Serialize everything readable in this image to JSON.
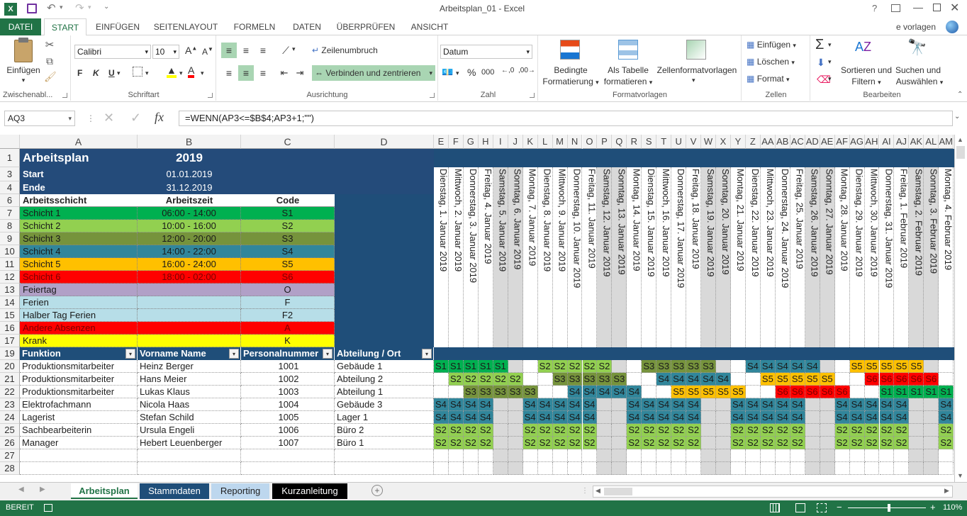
{
  "window": {
    "title": "Arbeitsplan_01 - Excel",
    "help": "?"
  },
  "tabs": {
    "file": "DATEI",
    "items": [
      "START",
      "EINFÜGEN",
      "SEITENLAYOUT",
      "FORMELN",
      "DATEN",
      "ÜBERPRÜFEN",
      "ANSICHT"
    ],
    "active": "START",
    "user": "e vorlagen"
  },
  "ribbon": {
    "clipboard": {
      "label": "Zwischenabl...",
      "paste": "Einfügen"
    },
    "font": {
      "label": "Schriftart",
      "name": "Calibri",
      "size": "10",
      "bold": "F",
      "italic": "K",
      "underline": "U"
    },
    "align": {
      "label": "Ausrichtung",
      "wrap": "Zeilenumbruch",
      "merge": "Verbinden und zentrieren"
    },
    "number": {
      "label": "Zahl",
      "format": "Datum",
      "percent": "%",
      "thousands": "000"
    },
    "styles": {
      "label": "Formatvorlagen",
      "cond1": "Bedingte",
      "cond2": "Formatierung",
      "table1": "Als Tabelle",
      "table2": "formatieren",
      "cell": "Zellenformatvorlagen"
    },
    "cells": {
      "label": "Zellen",
      "insert": "Einfügen",
      "delete": "Löschen",
      "format": "Format"
    },
    "edit": {
      "label": "Bearbeiten",
      "sort1": "Sortieren und",
      "sort2": "Filtern",
      "find1": "Suchen und",
      "find2": "Auswählen"
    }
  },
  "formula": {
    "namebox": "AQ3",
    "fx": "fx",
    "content": "=WENN(AP3<=$B$4;AP3+1;\"\")"
  },
  "columns": {
    "fixed": [
      "A",
      "B",
      "C",
      "D"
    ],
    "dates": [
      "E",
      "F",
      "G",
      "H",
      "I",
      "J",
      "K",
      "L",
      "M",
      "N",
      "O",
      "P",
      "Q",
      "R",
      "S",
      "T",
      "U",
      "V",
      "W",
      "X",
      "Y",
      "Z",
      "AA",
      "AB",
      "AC",
      "AD",
      "AE",
      "AF",
      "AG",
      "AH",
      "AI",
      "AJ",
      "AK",
      "AL",
      "AM"
    ]
  },
  "rows": [
    "1",
    "3",
    "4",
    "6",
    "7",
    "8",
    "9",
    "10",
    "11",
    "12",
    "13",
    "14",
    "15",
    "16",
    "17",
    "19",
    "20",
    "21",
    "22",
    "23",
    "24",
    "25",
    "26",
    "27",
    "28"
  ],
  "plan": {
    "title": "Arbeitsplan",
    "year": "2019",
    "start_label": "Start",
    "start": "01.01.2019",
    "end_label": "Ende",
    "end": "31.12.2019",
    "legend_headers": [
      "Arbeitsschicht",
      "Arbeitszeit",
      "Code"
    ],
    "legend": [
      {
        "name": "Schicht 1",
        "time": "06:00 - 14:00",
        "code": "S1",
        "bg": "#00b050",
        "fg": "#1a1a1a"
      },
      {
        "name": "Schicht 2",
        "time": "10:00 - 16:00",
        "code": "S2",
        "bg": "#92d050",
        "fg": "#1a1a1a"
      },
      {
        "name": "Schicht 3",
        "time": "12:00 - 20:00",
        "code": "S3",
        "bg": "#76933c",
        "fg": "#1a1a1a"
      },
      {
        "name": "Schicht 4",
        "time": "14:00 - 22:00",
        "code": "S4",
        "bg": "#31869b",
        "fg": "#1a1a1a"
      },
      {
        "name": "Schicht 5",
        "time": "16:00 - 24:00",
        "code": "S5",
        "bg": "#ffc000",
        "fg": "#1a1a1a"
      },
      {
        "name": "Schicht 6",
        "time": "18:00 - 02:00",
        "code": "S6",
        "bg": "#ff0000",
        "fg": "#7a0000"
      },
      {
        "name": "Feiertag",
        "time": "",
        "code": "O",
        "bg": "#b1a0c7",
        "fg": "#1a1a1a"
      },
      {
        "name": "Ferien",
        "time": "",
        "code": "F",
        "bg": "#b7dee8",
        "fg": "#1a1a1a"
      },
      {
        "name": "Halber Tag Ferien",
        "time": "",
        "code": "F2",
        "bg": "#b7dee8",
        "fg": "#1a1a1a"
      },
      {
        "name": "Andere Absenzen",
        "time": "",
        "code": "A",
        "bg": "#ff0000",
        "fg": "#7a0000"
      },
      {
        "name": "Krank",
        "time": "",
        "code": "K",
        "bg": "#ffff00",
        "fg": "#1a1a1a"
      }
    ]
  },
  "dates": [
    "Dienstag, 1. Januar 2019",
    "Mittwoch, 2. Januar 2019",
    "Donnerstag, 3. Januar 2019",
    "Freitag, 4. Januar 2019",
    "Samstag, 5. Januar 2019",
    "Sonntag, 6. Januar 2019",
    "Montag, 7. Januar 2019",
    "Dienstag, 8. Januar 2019",
    "Mittwoch, 9. Januar 2019",
    "Donnerstag, 10. Januar 2019",
    "Freitag, 11. Januar 2019",
    "Samstag, 12. Januar 2019",
    "Sonntag, 13. Januar 2019",
    "Montag, 14. Januar 2019",
    "Dienstag, 15. Januar 2019",
    "Mittwoch, 16. Januar 2019",
    "Donnerstag, 17. Januar 2019",
    "Freitag, 18. Januar 2019",
    "Samstag, 19. Januar 2019",
    "Sonntag, 20. Januar 2019",
    "Montag, 21. Januar 2019",
    "Dienstag, 22. Januar 2019",
    "Mittwoch, 23. Januar 2019",
    "Donnerstag, 24. Januar 2019",
    "Freitag, 25. Januar 2019",
    "Samstag, 26. Januar 2019",
    "Sonntag, 27. Januar 2019",
    "Montag, 28. Januar 2019",
    "Dienstag, 29. Januar 2019",
    "Mittwoch, 30. Januar 2019",
    "Donnerstag, 31. Januar 2019",
    "Freitag, 1. Februar 2019",
    "Samstag, 2. Februar 2019",
    "Sonntag, 3. Februar 2019",
    "Montag, 4. Februar 2019"
  ],
  "table_headers": [
    "Funktion",
    "Vorname Name",
    "Personalnummer",
    "Abteilung / Ort"
  ],
  "employees": [
    {
      "funktion": "Produktionsmitarbeiter",
      "name": "Heinz Berger",
      "nr": "1001",
      "abt": "Gebäude 1",
      "shifts": [
        "S1",
        "S1",
        "S1",
        "S1",
        "S1",
        "",
        "",
        "S2",
        "S2",
        "S2",
        "S2",
        "S2",
        "",
        "",
        "S3",
        "S3",
        "S3",
        "S3",
        "S3",
        "",
        "",
        "S4",
        "S4",
        "S4",
        "S4",
        "S4",
        "",
        "",
        "S5",
        "S5",
        "S5",
        "S5",
        "S5",
        "",
        ""
      ]
    },
    {
      "funktion": "Produktionsmitarbeiter",
      "name": "Hans Meier",
      "nr": "1002",
      "abt": "Abteilung 2",
      "shifts": [
        "",
        "S2",
        "S2",
        "S2",
        "S2",
        "S2",
        "",
        "",
        "S3",
        "S3",
        "S3",
        "S3",
        "S3",
        "",
        "",
        "S4",
        "S4",
        "S4",
        "S4",
        "S4",
        "",
        "",
        "S5",
        "S5",
        "S5",
        "S5",
        "S5",
        "",
        "",
        "S6",
        "S6",
        "S6",
        "S6",
        "S6",
        ""
      ]
    },
    {
      "funktion": "Produktionsmitarbeiter",
      "name": "Lukas Klaus",
      "nr": "1003",
      "abt": "Abteilung 1",
      "shifts": [
        "",
        "",
        "S3",
        "S3",
        "S3",
        "S3",
        "S3",
        "",
        "",
        "S4",
        "S4",
        "S4",
        "S4",
        "S4",
        "",
        "",
        "S5",
        "S5",
        "S5",
        "S5",
        "S5",
        "",
        "",
        "S6",
        "S6",
        "S6",
        "S6",
        "S6",
        "",
        "",
        "S1",
        "S1",
        "S1",
        "S1",
        "S1"
      ]
    },
    {
      "funktion": "Elektrofachmann",
      "name": "Nicola Haas",
      "nr": "1004",
      "abt": "Gebäude 3",
      "shifts": [
        "S4",
        "S4",
        "S4",
        "S4",
        "",
        "",
        "S4",
        "S4",
        "S4",
        "S4",
        "S4",
        "",
        "",
        "S4",
        "S4",
        "S4",
        "S4",
        "S4",
        "",
        "",
        "S4",
        "S4",
        "S4",
        "S4",
        "S4",
        "",
        "",
        "S4",
        "S4",
        "S4",
        "S4",
        "S4",
        "",
        "",
        "S4"
      ]
    },
    {
      "funktion": "Lagerist",
      "name": "Stefan Schild",
      "nr": "1005",
      "abt": "Lager 1",
      "shifts": [
        "S4",
        "S4",
        "S4",
        "S4",
        "",
        "",
        "S4",
        "S4",
        "S4",
        "S4",
        "S4",
        "",
        "",
        "S4",
        "S4",
        "S4",
        "S4",
        "S4",
        "",
        "",
        "S4",
        "S4",
        "S4",
        "S4",
        "S4",
        "",
        "",
        "S4",
        "S4",
        "S4",
        "S4",
        "S4",
        "",
        "",
        "S4"
      ]
    },
    {
      "funktion": "Sachbearbeiterin",
      "name": "Ursula Engeli",
      "nr": "1006",
      "abt": "Büro 2",
      "shifts": [
        "S2",
        "S2",
        "S2",
        "S2",
        "",
        "",
        "S2",
        "S2",
        "S2",
        "S2",
        "S2",
        "",
        "",
        "S2",
        "S2",
        "S2",
        "S2",
        "S2",
        "",
        "",
        "S2",
        "S2",
        "S2",
        "S2",
        "S2",
        "",
        "",
        "S2",
        "S2",
        "S2",
        "S2",
        "S2",
        "",
        "",
        "S2"
      ]
    },
    {
      "funktion": "Manager",
      "name": "Hebert Leuenberger",
      "nr": "1007",
      "abt": "Büro 1",
      "shifts": [
        "S2",
        "S2",
        "S2",
        "S2",
        "",
        "",
        "S2",
        "S2",
        "S2",
        "S2",
        "S2",
        "",
        "",
        "S2",
        "S2",
        "S2",
        "S2",
        "S2",
        "",
        "",
        "S2",
        "S2",
        "S2",
        "S2",
        "S2",
        "",
        "",
        "S2",
        "S2",
        "S2",
        "S2",
        "S2",
        "",
        "",
        "S2"
      ]
    }
  ],
  "colors": {
    "excel_green": "#217346",
    "header_blue": "#1f4e79",
    "weekend": "#d9d9d9",
    "title_blue": "#244b7a"
  },
  "sheets": [
    {
      "name": "Arbeitsplan",
      "bg": "#ffffff",
      "fg": "#217346"
    },
    {
      "name": "Stammdaten",
      "bg": "#1f4e79",
      "fg": "#ffffff"
    },
    {
      "name": "Reporting",
      "bg": "#bdd7ee",
      "fg": "#1f1f1f"
    },
    {
      "name": "Kurzanleitung",
      "bg": "#000000",
      "fg": "#ffffff"
    }
  ],
  "status": {
    "ready": "BEREIT",
    "zoom": "110%"
  }
}
